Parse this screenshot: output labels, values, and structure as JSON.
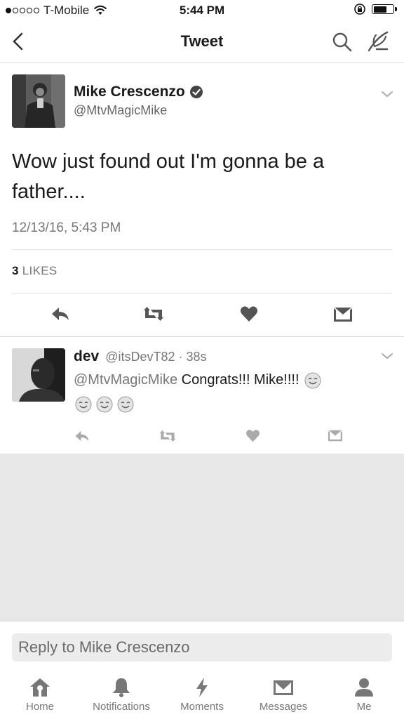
{
  "status_bar": {
    "carrier": "T-Mobile",
    "time": "5:44 PM",
    "signal_filled": 1,
    "signal_total": 5,
    "battery_level": 0.7
  },
  "nav": {
    "title": "Tweet"
  },
  "tweet": {
    "author_name": "Mike Crescenzo",
    "handle": "@MtvMagicMike",
    "verified": true,
    "text": "Wow just found out I'm gonna be a father....",
    "timestamp": "12/13/16, 5:43 PM",
    "likes_count": "3",
    "likes_label": "LIKES"
  },
  "reply": {
    "author_name": "dev",
    "handle": "@itsDevT82",
    "separator": "·",
    "age": "38s",
    "mention": "@MtvMagicMike",
    "text": "Congrats!!! Mike!!!!",
    "emoji_count": 4
  },
  "reply_bar": {
    "placeholder": "Reply to Mike Crescenzo"
  },
  "tabs": [
    {
      "label": "Home",
      "icon": "home-icon"
    },
    {
      "label": "Notifications",
      "icon": "bell-icon"
    },
    {
      "label": "Moments",
      "icon": "lightning-icon"
    },
    {
      "label": "Messages",
      "icon": "envelope-icon"
    },
    {
      "label": "Me",
      "icon": "person-icon"
    }
  ],
  "colors": {
    "text": "#1a1a1a",
    "secondary": "#777777",
    "background_gray": "#e8e8e8"
  }
}
